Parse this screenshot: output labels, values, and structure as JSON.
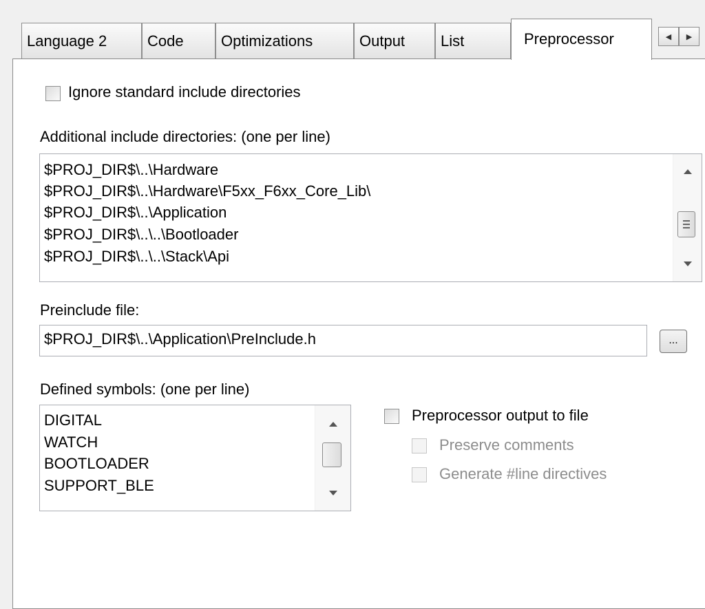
{
  "tabs": [
    {
      "label": "Language 2",
      "active": false
    },
    {
      "label": "Code",
      "active": false
    },
    {
      "label": "Optimizations",
      "active": false
    },
    {
      "label": "Output",
      "active": false
    },
    {
      "label": "List",
      "active": false
    },
    {
      "label": "Preprocessor",
      "active": true
    }
  ],
  "tab_scroll": {
    "left_icon": "arrow-left-icon",
    "right_icon": "arrow-right-icon"
  },
  "ignore_std_include": {
    "label": "Ignore standard include directories",
    "checked": false
  },
  "include_dirs": {
    "label": "Additional include directories: (one per line)",
    "lines": [
      "$PROJ_DIR$\\..\\Hardware",
      "$PROJ_DIR$\\..\\Hardware\\F5xx_F6xx_Core_Lib\\",
      "$PROJ_DIR$\\..\\Application",
      "$PROJ_DIR$\\..\\..\\Bootloader",
      "$PROJ_DIR$\\..\\..\\Stack\\Api"
    ]
  },
  "preinclude": {
    "label": "Preinclude file:",
    "value": "$PROJ_DIR$\\..\\Application\\PreInclude.h",
    "browse_label": "..."
  },
  "defined_symbols": {
    "label": "Defined symbols: (one per line)",
    "lines": [
      "DIGITAL",
      "WATCH",
      "BOOTLOADER",
      "SUPPORT_BLE"
    ]
  },
  "preproc_output": {
    "label": "Preprocessor output to file",
    "checked": false
  },
  "preserve_comments": {
    "label": "Preserve comments",
    "enabled": false
  },
  "line_directives": {
    "label": "Generate #line directives",
    "enabled": false
  }
}
